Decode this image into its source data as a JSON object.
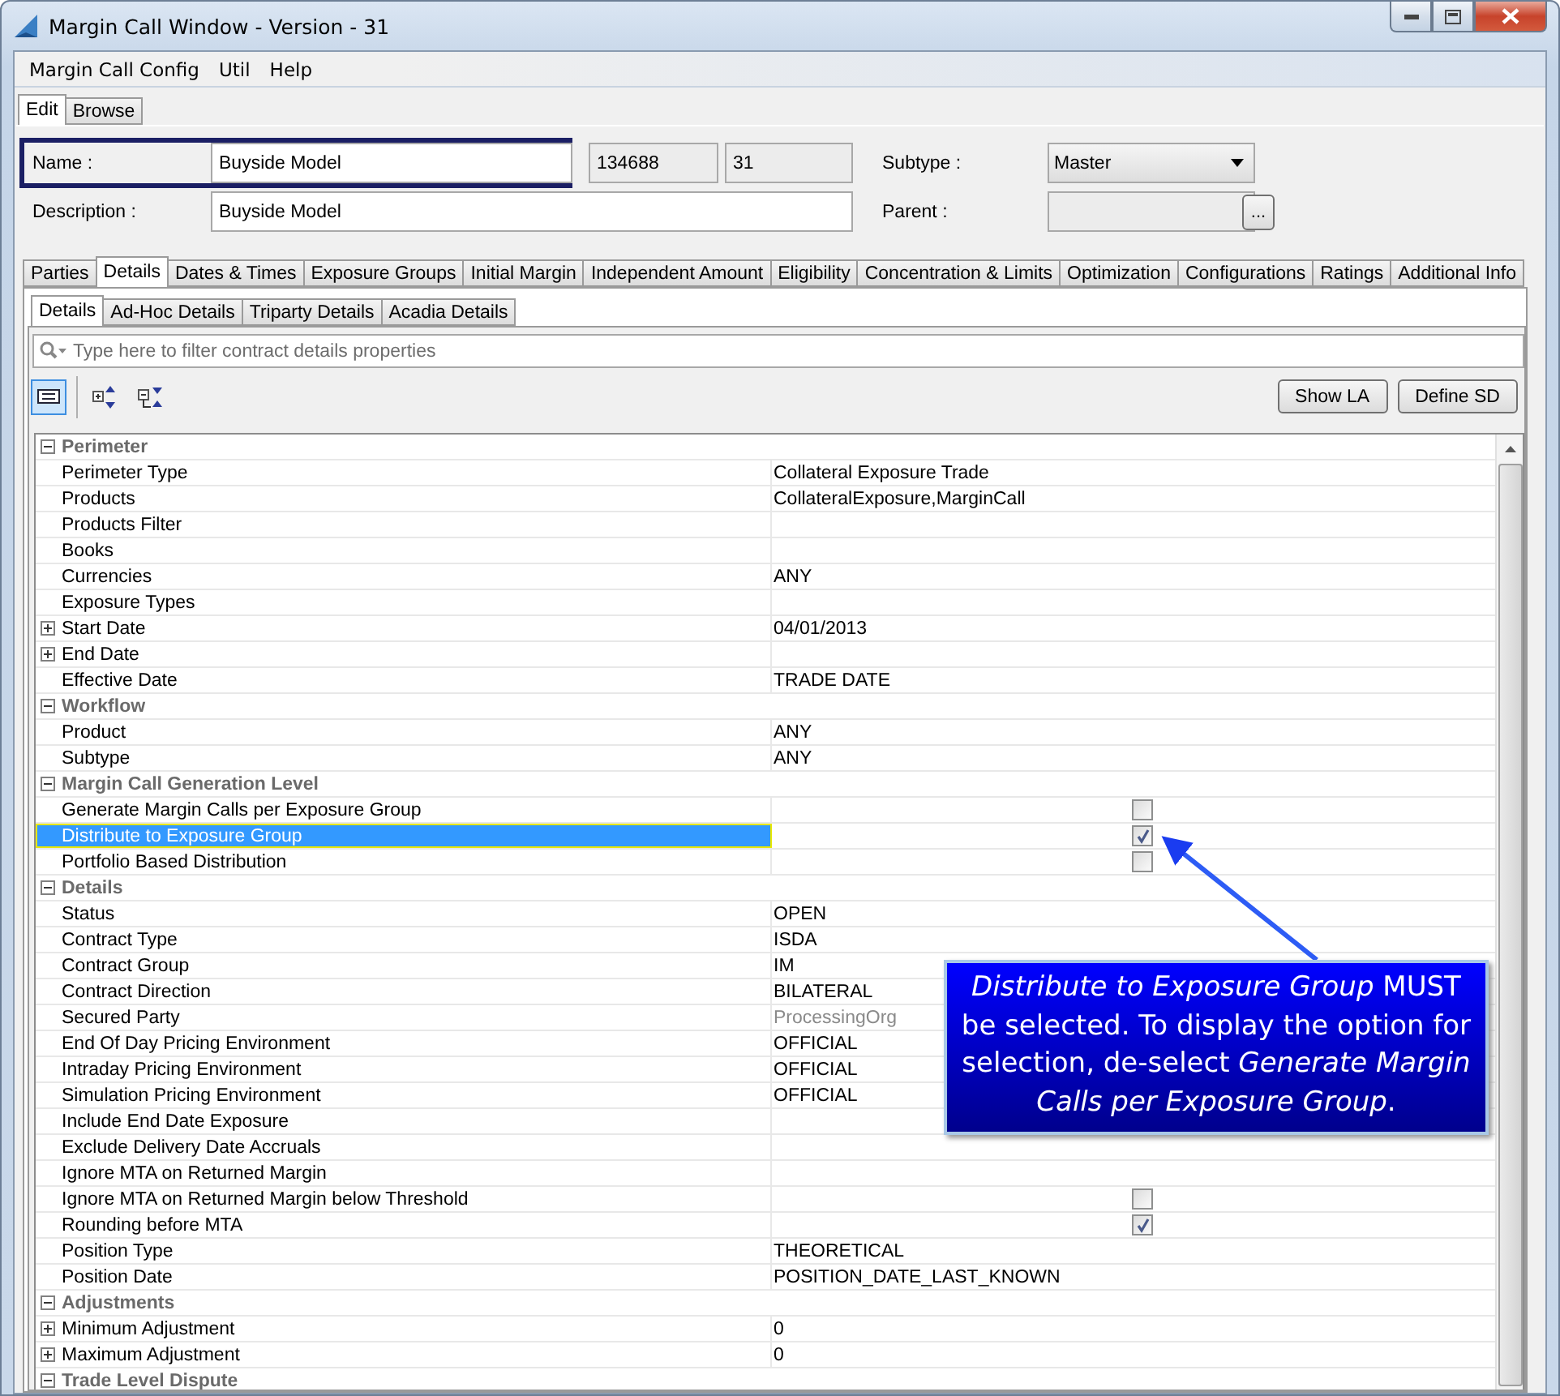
{
  "window": {
    "title": "Margin Call Window - Version - 31"
  },
  "menu": [
    "Margin Call Config",
    "Util",
    "Help"
  ],
  "mode_tabs": [
    {
      "label": "Edit",
      "selected": true
    },
    {
      "label": "Browse",
      "selected": false
    }
  ],
  "form": {
    "name_label": "Name :",
    "name_value": "Buyside Model",
    "id": "134688",
    "version": "31",
    "subtype_label": "Subtype :",
    "subtype_value": "Master",
    "description_label": "Description :",
    "description_value": "Buyside  Model",
    "parent_label": "Parent :",
    "parent_button": "..."
  },
  "tabs": [
    {
      "label": "Parties",
      "selected": false
    },
    {
      "label": "Details",
      "selected": true
    },
    {
      "label": "Dates & Times",
      "selected": false
    },
    {
      "label": "Exposure Groups",
      "selected": false
    },
    {
      "label": "Initial Margin",
      "selected": false
    },
    {
      "label": "Independent Amount",
      "selected": false
    },
    {
      "label": "Eligibility",
      "selected": false
    },
    {
      "label": "Concentration & Limits",
      "selected": false
    },
    {
      "label": "Optimization",
      "selected": false
    },
    {
      "label": "Configurations",
      "selected": false
    },
    {
      "label": "Ratings",
      "selected": false
    },
    {
      "label": "Additional Info",
      "selected": false
    }
  ],
  "sub_tabs": [
    {
      "label": "Details",
      "selected": true
    },
    {
      "label": "Ad-Hoc Details",
      "selected": false
    },
    {
      "label": "Triparty Details",
      "selected": false
    },
    {
      "label": "Acadia Details",
      "selected": false
    }
  ],
  "filter": {
    "placeholder": "Type here to filter contract details properties"
  },
  "buttons": [
    "Show LA",
    "Define SD"
  ],
  "groups": [
    {
      "title": "Perimeter",
      "items": [
        {
          "label": "Perimeter Type",
          "kind": "text",
          "value": "Collateral Exposure Trade",
          "expandable": false,
          "selected": false
        },
        {
          "label": "Products",
          "kind": "text",
          "value": "CollateralExposure,MarginCall",
          "expandable": false,
          "selected": false
        },
        {
          "label": "Products Filter",
          "kind": "text",
          "expandable": false,
          "selected": false
        },
        {
          "label": "Books",
          "kind": "text",
          "expandable": false,
          "selected": false
        },
        {
          "label": "Currencies",
          "kind": "text",
          "value": "ANY",
          "expandable": false,
          "selected": false
        },
        {
          "label": "Exposure Types",
          "kind": "text",
          "expandable": false,
          "selected": false
        },
        {
          "label": "Start Date",
          "kind": "text",
          "value": "04/01/2013",
          "expandable": true,
          "selected": false
        },
        {
          "label": "End Date",
          "kind": "text",
          "expandable": true,
          "selected": false
        },
        {
          "label": "Effective Date",
          "kind": "text",
          "value": "TRADE DATE",
          "expandable": false,
          "selected": false
        }
      ]
    },
    {
      "title": "Workflow",
      "items": [
        {
          "label": "Product",
          "kind": "text",
          "value": "ANY",
          "expandable": false,
          "selected": false
        },
        {
          "label": "Subtype",
          "kind": "text",
          "value": "ANY",
          "expandable": false,
          "selected": false
        }
      ]
    },
    {
      "title": "Margin Call Generation Level",
      "items": [
        {
          "label": "Generate Margin Calls per Exposure Group",
          "kind": "checkbox",
          "checked": false,
          "expandable": false,
          "selected": false
        },
        {
          "label": "Distribute to Exposure Group",
          "kind": "checkbox",
          "checked": true,
          "expandable": false,
          "selected": true
        },
        {
          "label": "Portfolio Based Distribution",
          "kind": "checkbox",
          "checked": false,
          "expandable": false,
          "selected": false
        }
      ]
    },
    {
      "title": "Details",
      "items": [
        {
          "label": "Status",
          "kind": "text",
          "value": "OPEN",
          "expandable": false,
          "selected": false
        },
        {
          "label": "Contract Type",
          "kind": "text",
          "value": "ISDA",
          "expandable": false,
          "selected": false
        },
        {
          "label": "Contract Group",
          "kind": "text",
          "value": "IM",
          "expandable": false,
          "selected": false
        },
        {
          "label": "Contract Direction",
          "kind": "text",
          "value": "BILATERAL",
          "expandable": false,
          "selected": false
        },
        {
          "label": "Secured Party",
          "kind": "muted",
          "value": "ProcessingOrg",
          "expandable": false,
          "selected": false
        },
        {
          "label": "End Of Day Pricing Environment",
          "kind": "text",
          "value": "OFFICIAL",
          "expandable": false,
          "selected": false
        },
        {
          "label": "Intraday Pricing Environment",
          "kind": "text",
          "value": "OFFICIAL",
          "expandable": false,
          "selected": false
        },
        {
          "label": "Simulation Pricing Environment",
          "kind": "text",
          "value": "OFFICIAL",
          "expandable": false,
          "selected": false
        },
        {
          "label": "Include End Date Exposure",
          "kind": "text",
          "expandable": false,
          "selected": false
        },
        {
          "label": "Exclude Delivery Date Accruals",
          "kind": "text",
          "expandable": false,
          "selected": false
        },
        {
          "label": "Ignore MTA on Returned Margin",
          "kind": "text",
          "expandable": false,
          "selected": false
        },
        {
          "label": "Ignore MTA on Returned Margin below Threshold",
          "kind": "checkbox",
          "checked": false,
          "expandable": false,
          "selected": false
        },
        {
          "label": "Rounding before MTA",
          "kind": "checkbox",
          "checked": true,
          "expandable": false,
          "selected": false
        },
        {
          "label": "Position Type",
          "kind": "text",
          "value": "THEORETICAL",
          "expandable": false,
          "selected": false
        },
        {
          "label": "Position Date",
          "kind": "text",
          "value": "POSITION_DATE_LAST_KNOWN",
          "expandable": false,
          "selected": false
        }
      ]
    },
    {
      "title": "Adjustments",
      "items": [
        {
          "label": "Minimum Adjustment",
          "kind": "text",
          "value": "0",
          "expandable": true,
          "selected": false
        },
        {
          "label": "Maximum Adjustment",
          "kind": "text",
          "value": "0",
          "expandable": true,
          "selected": false
        }
      ]
    },
    {
      "title": "Trade Level Dispute"
    }
  ],
  "callout": {
    "text": "*Distribute to Exposure Group* MUST be selected.   To display the option for selection, de-select *Generate Margin Calls per Exposure Group*."
  }
}
